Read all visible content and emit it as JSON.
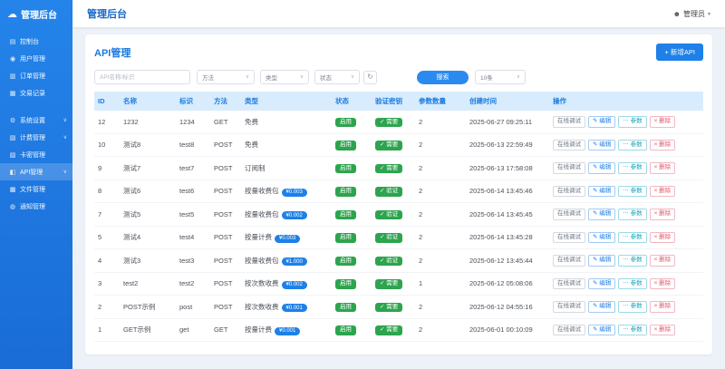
{
  "colors": {
    "primary": "#1e80e8",
    "sidebar": "#2484ea",
    "green": "#2da44e",
    "cyan": "#17a2b8",
    "red": "#e0566a",
    "table_header_bg": "#d8ecfd"
  },
  "icons": {
    "cloud": "☁",
    "dashboard": "▤",
    "users": "◉",
    "orders": "▥",
    "transactions": "▦",
    "settings": "⚙",
    "billing": "▧",
    "cards": "▨",
    "api": "◧",
    "files": "▩",
    "notify": "◍",
    "chevron": "∨",
    "caret": "▾",
    "user": "☻",
    "refresh": "↻",
    "edit": "✎",
    "params": "⋯",
    "delete": "×",
    "check": "✓"
  },
  "brand": {
    "title": "管理后台"
  },
  "sidebar": {
    "items": [
      {
        "key": "dashboard",
        "label": "控制台",
        "icon": "dashboard"
      },
      {
        "key": "users",
        "label": "用户管理",
        "icon": "users"
      },
      {
        "key": "orders",
        "label": "订单管理",
        "icon": "orders"
      },
      {
        "key": "transactions",
        "label": "交易记录",
        "icon": "transactions"
      },
      {
        "key": "settings",
        "label": "系统设置",
        "icon": "settings",
        "chevron": true,
        "group_gap": true
      },
      {
        "key": "billing",
        "label": "计费管理",
        "icon": "billing",
        "chevron": true
      },
      {
        "key": "cards",
        "label": "卡密管理",
        "icon": "cards"
      },
      {
        "key": "api",
        "label": "API管理",
        "icon": "api",
        "chevron": true,
        "active": true
      },
      {
        "key": "files",
        "label": "文件管理",
        "icon": "files"
      },
      {
        "key": "notify",
        "label": "通知管理",
        "icon": "notify"
      }
    ]
  },
  "header": {
    "title": "管理后台",
    "user": "管理员"
  },
  "page": {
    "title": "API管理",
    "create_button": "+ 新增API",
    "filters": {
      "keyword_placeholder": "API名称/标识",
      "method": "方法",
      "type": "类型",
      "status": "状态",
      "search": "搜索",
      "page_size": "10条"
    },
    "table": {
      "columns": [
        "ID",
        "名称",
        "标识",
        "方法",
        "类型",
        "状态",
        "验证密钥",
        "参数数量",
        "创建时间",
        "操作"
      ],
      "actions": {
        "debug": "在线调试",
        "edit": "编辑",
        "params": "参数",
        "delete": "删除"
      },
      "rows": [
        {
          "id": "12",
          "name": "1232",
          "key": "1234",
          "method": "GET",
          "type": "免费",
          "price": null,
          "status": "启用",
          "verify": "需要",
          "params": "2",
          "created": "2025-06-27 09:25:11"
        },
        {
          "id": "10",
          "name": "测试8",
          "key": "test8",
          "method": "POST",
          "type": "免费",
          "price": null,
          "status": "启用",
          "verify": "需要",
          "params": "2",
          "created": "2025-06-13 22:59:49"
        },
        {
          "id": "9",
          "name": "测试7",
          "key": "test7",
          "method": "POST",
          "type": "订阅制",
          "price": null,
          "status": "启用",
          "verify": "需要",
          "params": "2",
          "created": "2025-06-13 17:58:08"
        },
        {
          "id": "8",
          "name": "测试6",
          "key": "test6",
          "method": "POST",
          "type": "按量收费包",
          "price": "¥0.003",
          "status": "启用",
          "verify": "验证",
          "params": "2",
          "created": "2025-06-14 13:45:46"
        },
        {
          "id": "7",
          "name": "测试5",
          "key": "test5",
          "method": "POST",
          "type": "按量收费包",
          "price": "¥0.002",
          "status": "启用",
          "verify": "验证",
          "params": "2",
          "created": "2025-06-14 13:45:45"
        },
        {
          "id": "5",
          "name": "测试4",
          "key": "test4",
          "method": "POST",
          "type": "按量计费",
          "price": "¥0.003",
          "status": "启用",
          "verify": "验证",
          "params": "2",
          "created": "2025-06-14 13:45:28"
        },
        {
          "id": "4",
          "name": "测试3",
          "key": "test3",
          "method": "POST",
          "type": "按量收费包",
          "price": "¥1.000",
          "status": "启用",
          "verify": "验证",
          "params": "2",
          "created": "2025-06-12 13:45:44"
        },
        {
          "id": "3",
          "name": "test2",
          "key": "test2",
          "method": "POST",
          "type": "按次数收费",
          "price": "¥0.002",
          "status": "启用",
          "verify": "需要",
          "params": "1",
          "created": "2025-06-12 05:08:06"
        },
        {
          "id": "2",
          "name": "POST示例",
          "key": "post",
          "method": "POST",
          "type": "按次数收费",
          "price": "¥0.001",
          "status": "启用",
          "verify": "需要",
          "params": "2",
          "created": "2025-06-12 04:55:16"
        },
        {
          "id": "1",
          "name": "GET示例",
          "key": "get",
          "method": "GET",
          "type": "按量计费",
          "price": "¥0.001",
          "status": "启用",
          "verify": "需要",
          "params": "2",
          "created": "2025-06-01 00:10:09"
        }
      ]
    }
  }
}
